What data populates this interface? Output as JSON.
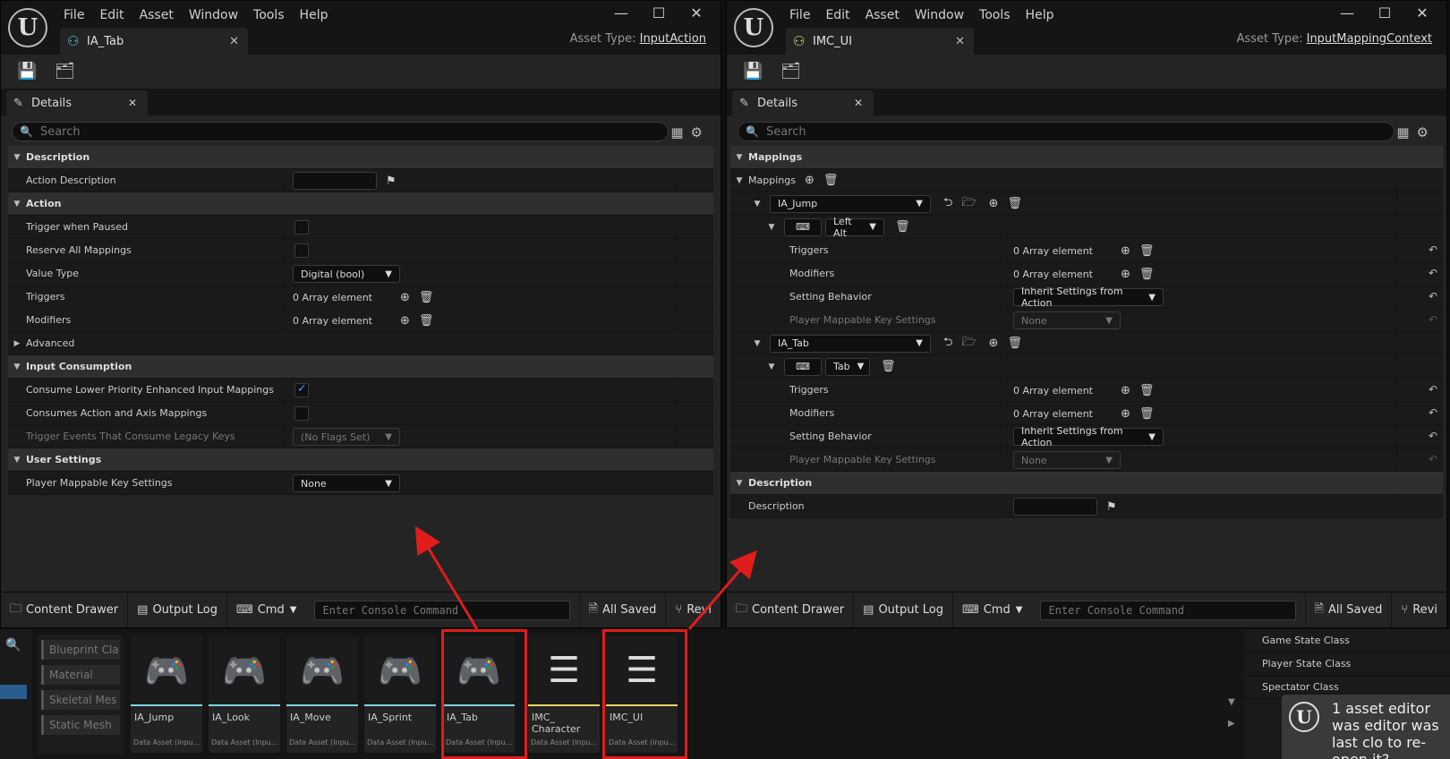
{
  "menu": [
    "File",
    "Edit",
    "Asset",
    "Window",
    "Tools",
    "Help"
  ],
  "windowA": {
    "tab_title": "IA_Tab",
    "asset_type_label": "Asset Type:",
    "asset_type_value": "InputAction",
    "panel_title": "Details",
    "search_placeholder": "Search",
    "rows": {
      "cat_description": "Description",
      "action_description": "Action Description",
      "cat_action": "Action",
      "trigger_when_paused": "Trigger when Paused",
      "reserve_all": "Reserve All Mappings",
      "value_type": "Value Type",
      "value_type_value": "Digital (bool)",
      "triggers": "Triggers",
      "triggers_value": "0 Array element",
      "modifiers": "Modifiers",
      "modifiers_value": "0 Array element",
      "advanced": "Advanced",
      "cat_input_consumption": "Input Consumption",
      "consume_lower": "Consume Lower Priority Enhanced Input Mappings",
      "consumes_action_axis": "Consumes Action and Axis Mappings",
      "trigger_events_legacy": "Trigger Events That Consume Legacy Keys",
      "trigger_events_value": "(No Flags Set)",
      "cat_user_settings": "User Settings",
      "player_mappable": "Player Mappable Key Settings",
      "player_mappable_value": "None"
    },
    "bottombar": {
      "content_drawer": "Content Drawer",
      "output_log": "Output Log",
      "cmd": "Cmd",
      "console_placeholder": "Enter Console Command",
      "all_saved": "All Saved",
      "revision": "Revi"
    }
  },
  "windowB": {
    "tab_title": "IMC_UI",
    "asset_type_label": "Asset Type:",
    "asset_type_value": "InputMappingContext",
    "panel_title": "Details",
    "search_placeholder": "Search",
    "rows": {
      "cat_mappings": "Mappings",
      "mappings": "Mappings",
      "map1_action": "IA_Jump",
      "map1_key": "Left Alt",
      "map2_action": "IA_Tab",
      "map2_key": "Tab",
      "triggers": "Triggers",
      "modifiers": "Modifiers",
      "array_value": "0 Array element",
      "setting_behavior": "Setting Behavior",
      "setting_behavior_value": "Inherit Settings from Action",
      "player_mappable": "Player Mappable Key Settings",
      "player_mappable_value": "None",
      "cat_description": "Description",
      "description": "Description"
    },
    "bottombar": {
      "content_drawer": "Content Drawer",
      "output_log": "Output Log",
      "cmd": "Cmd",
      "console_placeholder": "Enter Console Command",
      "all_saved": "All Saved",
      "revision": "Revi"
    }
  },
  "drawer": {
    "filters": [
      "Blueprint Cla",
      "Material",
      "Skeletal Mes",
      "Static Mesh"
    ],
    "assets": [
      {
        "name": "IA_Jump",
        "sub": "Data Asset (Inpu..."
      },
      {
        "name": "IA_Look",
        "sub": "Data Asset (Inpu..."
      },
      {
        "name": "IA_Move",
        "sub": "Data Asset (Inpu..."
      },
      {
        "name": "IA_Sprint",
        "sub": "Data Asset (Inpu..."
      },
      {
        "name": "IA_Tab",
        "sub": "Data Asset (Inpu..."
      },
      {
        "name": "IMC_\nCharacter",
        "sub": "Data Asset (Inpu..."
      },
      {
        "name": "IMC_UI",
        "sub": "Data Asset (Inpu..."
      }
    ]
  },
  "right_panel": {
    "rows": [
      "Game State Class",
      "Player State Class",
      "Spectator Class"
    ],
    "toast": "1 asset editor was editor was last clo to re-open it?"
  },
  "colors": {
    "accent_blue": "#3b9bff",
    "highlight_red": "#e01c1c",
    "input_action_bar": "#7fd6e8",
    "mapping_context_bar": "#e8d86a"
  }
}
